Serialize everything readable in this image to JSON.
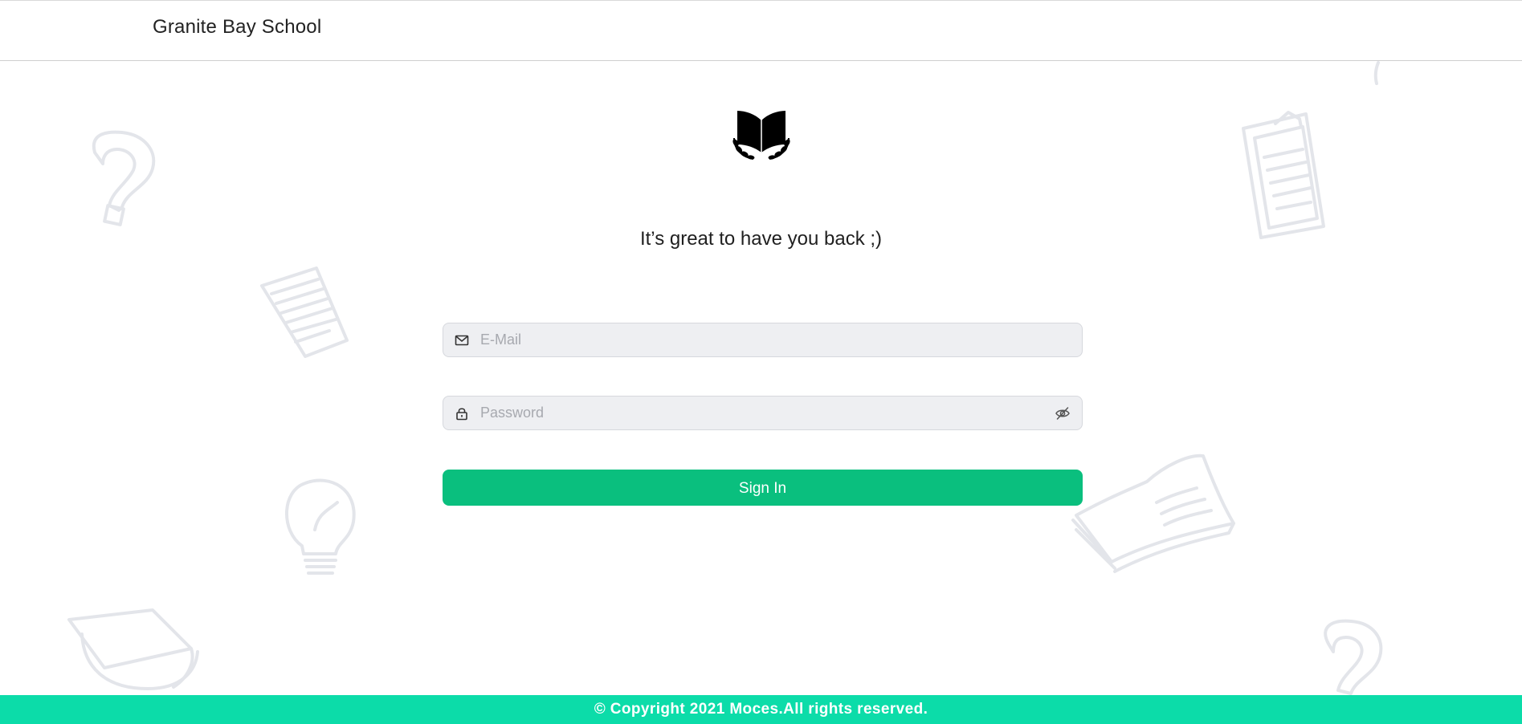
{
  "header": {
    "school_name": "Granite Bay School"
  },
  "logo": {
    "icon": "open-book-with-laurel-icon"
  },
  "login": {
    "welcome": "It’s great to have you back ;)",
    "email": {
      "placeholder": "E-Mail",
      "value": "",
      "icon": "envelope-icon"
    },
    "password": {
      "placeholder": "Password",
      "value": "",
      "icon": "lock-icon",
      "toggle_icon": "eye-slash-icon"
    },
    "submit_label": "Sign In"
  },
  "footer": {
    "copyright": "© Copyright 2021 Moces.All rights reserved."
  },
  "colors": {
    "primary_button": "#0abf7e",
    "footer_bg": "#0cdca9",
    "input_bg": "#eeeff2",
    "doodle_stroke": "#e3e5ea"
  },
  "background_doodles": [
    "question-mark-icon",
    "paper-sheet-icon",
    "lightbulb-icon",
    "graduation-cap-icon",
    "clipboard-icon",
    "open-book-icon",
    "question-mark-icon"
  ]
}
